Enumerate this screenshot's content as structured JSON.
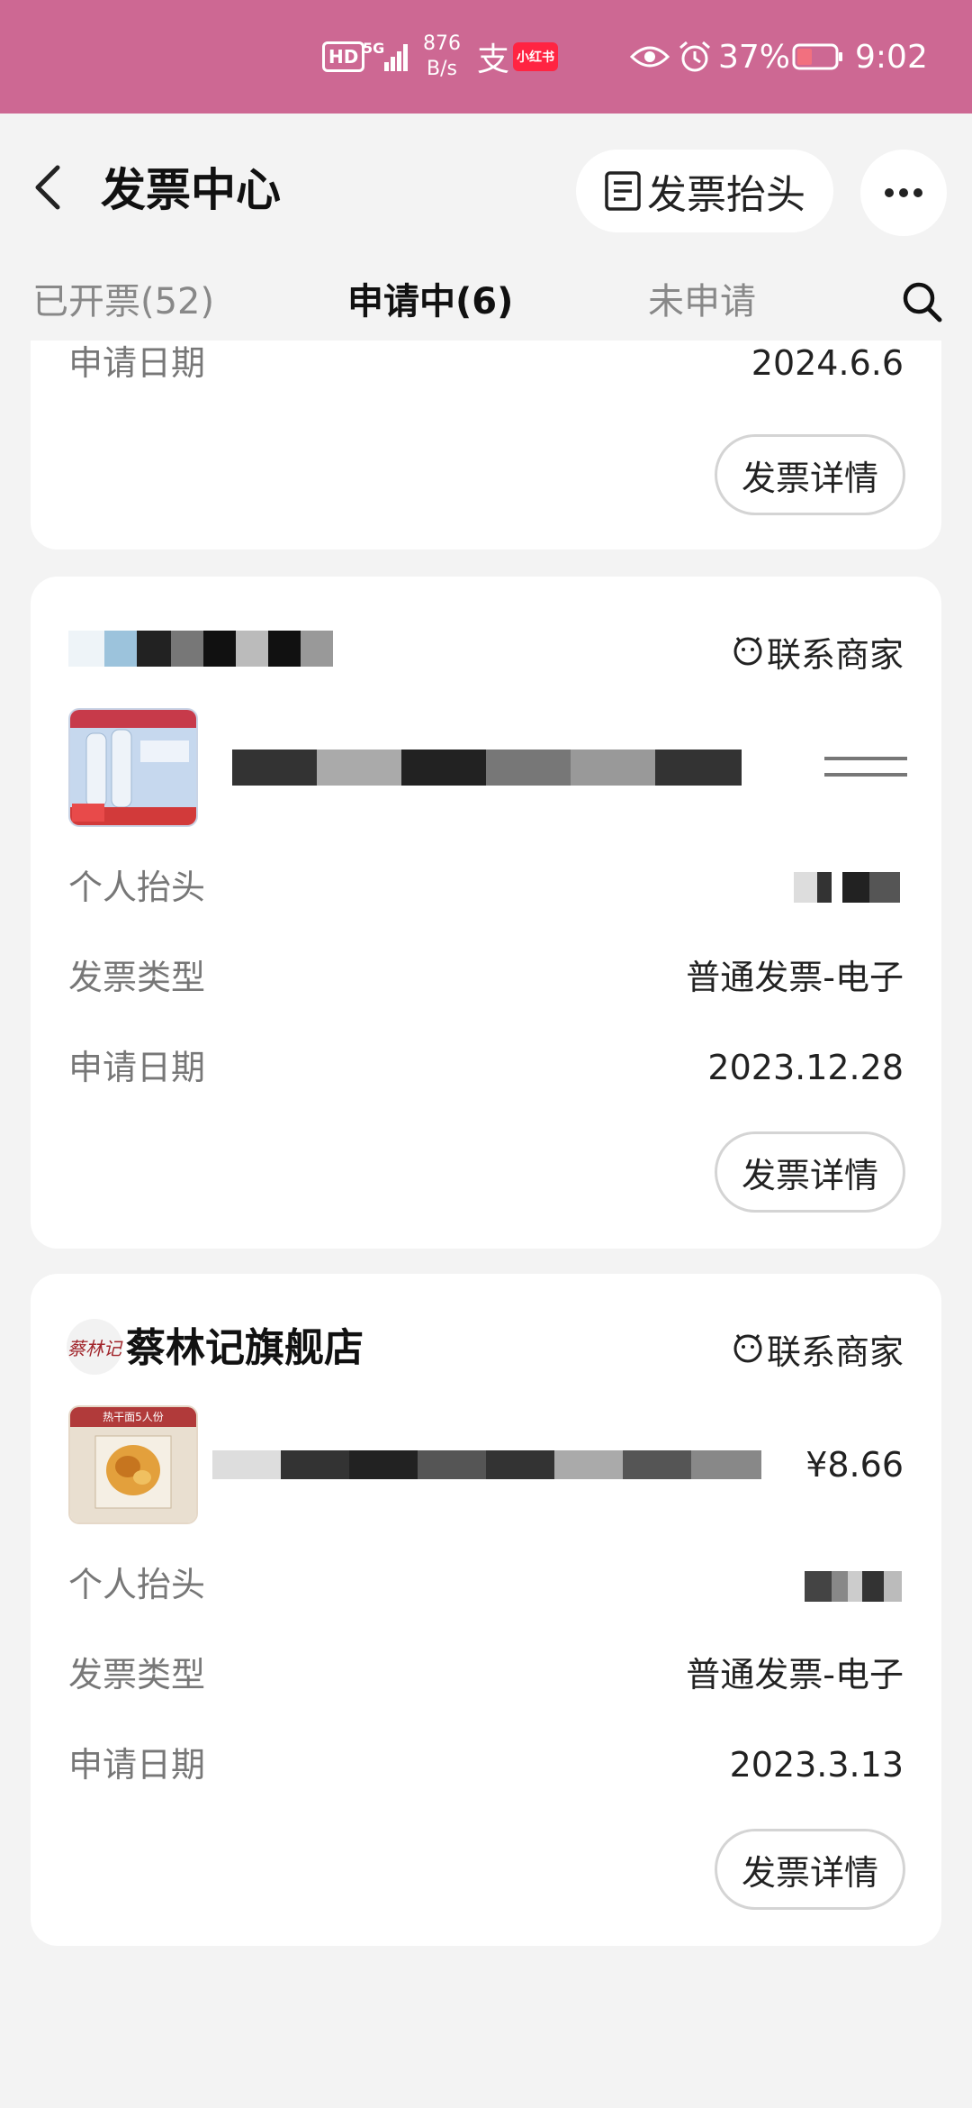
{
  "status_bar": {
    "hd": "HD",
    "network": "5G",
    "speed_value": "876",
    "speed_unit": "B/s",
    "alipay_glyph": "支",
    "xhs_label": "小红书",
    "battery": "37%",
    "time": "9:02"
  },
  "header": {
    "title": "发票中心",
    "title_button": "发票抬头"
  },
  "tabs": [
    {
      "label": "已开票(52)",
      "active": false
    },
    {
      "label": "申请中(6)",
      "active": true
    },
    {
      "label": "未申请",
      "active": false
    }
  ],
  "cards": [
    {
      "rows": [
        {
          "label": "申请日期",
          "value": "2024.6.6"
        }
      ],
      "detail_button": "发票详情"
    },
    {
      "contact": "联系商家",
      "rows": [
        {
          "label": "个人抬头",
          "value": ""
        },
        {
          "label": "发票类型",
          "value": "普通发票-电子"
        },
        {
          "label": "申请日期",
          "value": "2023.12.28"
        }
      ],
      "detail_button": "发票详情"
    },
    {
      "shop_name": "蔡林记旗舰店",
      "shop_logo_text": "蔡林记",
      "contact": "联系商家",
      "price": "¥8.66",
      "product_badge": "热干面5人份",
      "rows": [
        {
          "label": "个人抬头",
          "value": ""
        },
        {
          "label": "发票类型",
          "value": "普通发票-电子"
        },
        {
          "label": "申请日期",
          "value": "2023.3.13"
        }
      ],
      "detail_button": "发票详情"
    }
  ],
  "colors": {
    "status_bar": "#cd6893",
    "page_bg": "#f3f3f3",
    "card_bg": "#ffffff"
  },
  "icons": {
    "back": "chevron-left-icon",
    "invoice_title": "invoice-icon",
    "more": "more-dots-icon",
    "search": "search-icon",
    "contact": "chat-face-icon"
  }
}
